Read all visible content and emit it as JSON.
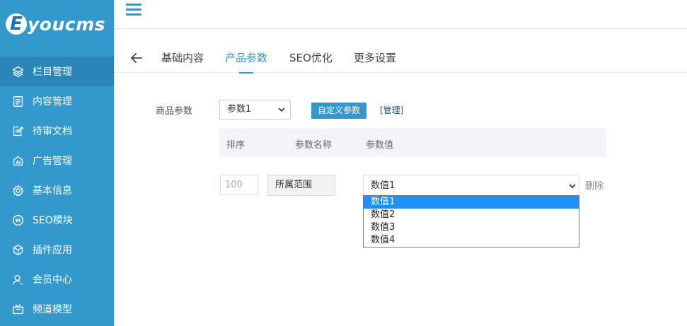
{
  "logo": {
    "mark": "E",
    "text": "youcms"
  },
  "sidebar": {
    "items": [
      {
        "label": "栏目管理",
        "icon": "layers-icon",
        "active": true
      },
      {
        "label": "内容管理",
        "icon": "document-icon"
      },
      {
        "label": "待审文档",
        "icon": "edit-document-icon"
      },
      {
        "label": "广告管理",
        "icon": "ad-icon"
      },
      {
        "label": "基本信息",
        "icon": "gear-icon"
      },
      {
        "label": "SEO模块",
        "icon": "link-icon"
      },
      {
        "label": "插件应用",
        "icon": "cube-icon"
      },
      {
        "label": "会员中心",
        "icon": "user-icon"
      },
      {
        "label": "频道模型",
        "icon": "tv-icon"
      }
    ]
  },
  "tabs": [
    {
      "label": "基础内容"
    },
    {
      "label": "产品参数",
      "active": true
    },
    {
      "label": "SEO优化"
    },
    {
      "label": "更多设置"
    }
  ],
  "form": {
    "goods_param_label": "商品参数",
    "param_select_value": "参数1",
    "custom_button": "自定义参数",
    "manage_link": "[管理]"
  },
  "table": {
    "headers": [
      "排序",
      "参数名称",
      "参数值"
    ],
    "row": {
      "sort_placeholder": "100",
      "name": "所属范围",
      "value_selected": "数值1",
      "delete_label": "删除"
    }
  },
  "dropdown": {
    "options": [
      "数值1",
      "数值2",
      "数值3",
      "数值4"
    ],
    "highlighted_index": 0
  },
  "colors": {
    "sidebar_bg": "#3398cc",
    "sidebar_active": "#2a86b8",
    "accent": "#3398cc",
    "dropdown_highlight": "#1e90ff"
  }
}
